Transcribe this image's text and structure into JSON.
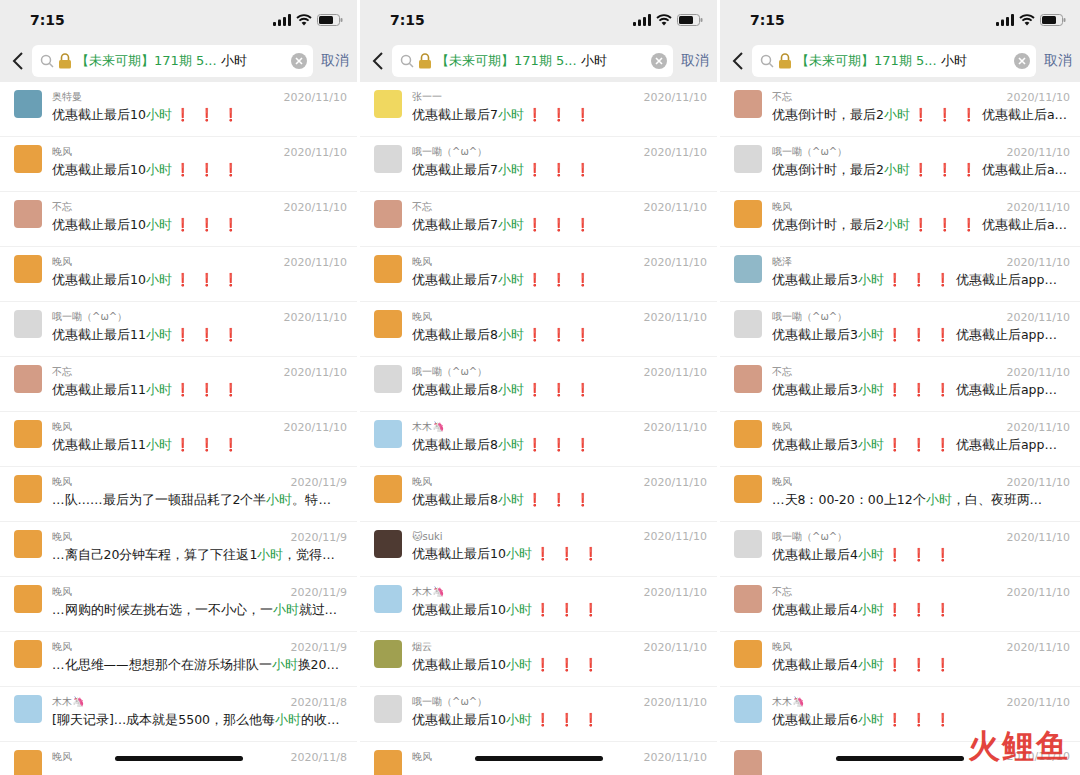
{
  "panels": [
    {
      "time": "7:15",
      "search": {
        "tag": "【未来可期】171期 5...",
        "query": "小时",
        "cancel": "取消"
      },
      "results": [
        {
          "name": "奥特曼",
          "date": "2020/11/10",
          "color": "#6a9fb5",
          "parts": [
            {
              "text": "优惠截止最后10",
              "kind": "plain"
            },
            {
              "text": "小时",
              "kind": "match"
            },
            {
              "text": "❗ ❗ ❗",
              "kind": "mark"
            }
          ]
        },
        {
          "name": "晚风",
          "date": "2020/11/10",
          "color": "#e8a040",
          "parts": [
            {
              "text": "优惠截止最后10",
              "kind": "plain"
            },
            {
              "text": "小时",
              "kind": "match"
            },
            {
              "text": "❗ ❗ ❗",
              "kind": "mark"
            }
          ]
        },
        {
          "name": "不忘",
          "date": "2020/11/10",
          "color": "#d39c86",
          "parts": [
            {
              "text": "优惠截止最后10",
              "kind": "plain"
            },
            {
              "text": "小时",
              "kind": "match"
            },
            {
              "text": "❗ ❗ ❗",
              "kind": "mark"
            }
          ]
        },
        {
          "name": "晚风",
          "date": "2020/11/10",
          "color": "#e8a040",
          "parts": [
            {
              "text": "优惠截止最后10",
              "kind": "plain"
            },
            {
              "text": "小时",
              "kind": "match"
            },
            {
              "text": "❗ ❗ ❗",
              "kind": "mark"
            }
          ]
        },
        {
          "name": "哦一嘞（^ω^）",
          "date": "2020/11/10",
          "color": "#d8d8d8",
          "parts": [
            {
              "text": "优惠截止最后11",
              "kind": "plain"
            },
            {
              "text": "小时",
              "kind": "match"
            },
            {
              "text": "❗ ❗ ❗",
              "kind": "mark"
            }
          ]
        },
        {
          "name": "不忘",
          "date": "2020/11/10",
          "color": "#d39c86",
          "parts": [
            {
              "text": "优惠截止最后11",
              "kind": "plain"
            },
            {
              "text": "小时",
              "kind": "match"
            },
            {
              "text": "❗ ❗ ❗",
              "kind": "mark"
            }
          ]
        },
        {
          "name": "晚风",
          "date": "2020/11/10",
          "color": "#e8a040",
          "parts": [
            {
              "text": "优惠截止最后11",
              "kind": "plain"
            },
            {
              "text": "小时",
              "kind": "match"
            },
            {
              "text": "❗ ❗ ❗",
              "kind": "mark"
            }
          ]
        },
        {
          "name": "晚风",
          "date": "2020/11/9",
          "color": "#e8a040",
          "parts": [
            {
              "text": "…队……最后为了一顿甜品耗了2个半",
              "kind": "plain"
            },
            {
              "text": "小时",
              "kind": "match"
            },
            {
              "text": "。特…",
              "kind": "plain"
            }
          ]
        },
        {
          "name": "晚风",
          "date": "2020/11/9",
          "color": "#e8a040",
          "parts": [
            {
              "text": "…离自己20分钟车程，算了下往返1",
              "kind": "plain"
            },
            {
              "text": "小时",
              "kind": "match"
            },
            {
              "text": "，觉得…",
              "kind": "plain"
            }
          ]
        },
        {
          "name": "晚风",
          "date": "2020/11/9",
          "color": "#e8a040",
          "parts": [
            {
              "text": "…网购的时候左挑右选，一不小心，一",
              "kind": "plain"
            },
            {
              "text": "小时",
              "kind": "match"
            },
            {
              "text": "就过…",
              "kind": "plain"
            }
          ]
        },
        {
          "name": "晚风",
          "date": "2020/11/9",
          "color": "#e8a040",
          "parts": [
            {
              "text": "…化思维——想想那个在游乐场排队一",
              "kind": "plain"
            },
            {
              "text": "小时",
              "kind": "match"
            },
            {
              "text": "换20…",
              "kind": "plain"
            }
          ]
        },
        {
          "name": "木木🦄",
          "date": "2020/11/8",
          "color": "#a8d0e8",
          "parts": [
            {
              "text": "[聊天记录]…成本就是5500，那么他每",
              "kind": "plain"
            },
            {
              "text": "小时",
              "kind": "match"
            },
            {
              "text": "的收…",
              "kind": "plain"
            }
          ]
        },
        {
          "name": "晚风",
          "date": "2020/11/8",
          "color": "#e8a040",
          "parts": []
        }
      ]
    },
    {
      "time": "7:15",
      "search": {
        "tag": "【未来可期】171期 5...",
        "query": "小时",
        "cancel": "取消"
      },
      "results": [
        {
          "name": "张一一",
          "date": "2020/11/10",
          "color": "#f0d860",
          "parts": [
            {
              "text": "优惠截止最后7",
              "kind": "plain"
            },
            {
              "text": "小时",
              "kind": "match"
            },
            {
              "text": "❗ ❗ ❗",
              "kind": "mark"
            }
          ]
        },
        {
          "name": "哦一嘞（^ω^）",
          "date": "2020/11/10",
          "color": "#d8d8d8",
          "parts": [
            {
              "text": "优惠截止最后7",
              "kind": "plain"
            },
            {
              "text": "小时",
              "kind": "match"
            },
            {
              "text": "❗ ❗ ❗",
              "kind": "mark"
            }
          ]
        },
        {
          "name": "不忘",
          "date": "2020/11/10",
          "color": "#d39c86",
          "parts": [
            {
              "text": "优惠截止最后7",
              "kind": "plain"
            },
            {
              "text": "小时",
              "kind": "match"
            },
            {
              "text": "❗ ❗ ❗",
              "kind": "mark"
            }
          ]
        },
        {
          "name": "晚风",
          "date": "2020/11/10",
          "color": "#e8a040",
          "parts": [
            {
              "text": "优惠截止最后7",
              "kind": "plain"
            },
            {
              "text": "小时",
              "kind": "match"
            },
            {
              "text": "❗ ❗ ❗",
              "kind": "mark"
            }
          ]
        },
        {
          "name": "晚风",
          "date": "2020/11/10",
          "color": "#e8a040",
          "parts": [
            {
              "text": "优惠截止最后8",
              "kind": "plain"
            },
            {
              "text": "小时",
              "kind": "match"
            },
            {
              "text": "❗ ❗ ❗",
              "kind": "mark"
            }
          ]
        },
        {
          "name": "哦一嘞（^ω^）",
          "date": "2020/11/10",
          "color": "#d8d8d8",
          "parts": [
            {
              "text": "优惠截止最后8",
              "kind": "plain"
            },
            {
              "text": "小时",
              "kind": "match"
            },
            {
              "text": "❗ ❗ ❗",
              "kind": "mark"
            }
          ]
        },
        {
          "name": "木木🦄",
          "date": "2020/11/10",
          "color": "#a8d0e8",
          "parts": [
            {
              "text": "优惠截止最后8",
              "kind": "plain"
            },
            {
              "text": "小时",
              "kind": "match"
            },
            {
              "text": "❗ ❗ ❗",
              "kind": "mark"
            }
          ]
        },
        {
          "name": "晚风",
          "date": "2020/11/10",
          "color": "#e8a040",
          "parts": [
            {
              "text": "优惠截止最后8",
              "kind": "plain"
            },
            {
              "text": "小时",
              "kind": "match"
            },
            {
              "text": "❗ ❗ ❗",
              "kind": "mark"
            }
          ]
        },
        {
          "name": "🐱suki",
          "date": "2020/11/10",
          "color": "#4e3a32",
          "parts": [
            {
              "text": "优惠截止最后10",
              "kind": "plain"
            },
            {
              "text": "小时",
              "kind": "match"
            },
            {
              "text": "❗ ❗ ❗",
              "kind": "mark"
            }
          ]
        },
        {
          "name": "木木🦄",
          "date": "2020/11/10",
          "color": "#a8d0e8",
          "parts": [
            {
              "text": "优惠截止最后10",
              "kind": "plain"
            },
            {
              "text": "小时",
              "kind": "match"
            },
            {
              "text": "❗ ❗ ❗",
              "kind": "mark"
            }
          ]
        },
        {
          "name": "烟云",
          "date": "2020/11/10",
          "color": "#a0a050",
          "parts": [
            {
              "text": "优惠截止最后10",
              "kind": "plain"
            },
            {
              "text": "小时",
              "kind": "match"
            },
            {
              "text": "❗ ❗ ❗",
              "kind": "mark"
            }
          ]
        },
        {
          "name": "哦一嘞（^ω^）",
          "date": "2020/11/10",
          "color": "#d8d8d8",
          "parts": [
            {
              "text": "优惠截止最后10",
              "kind": "plain"
            },
            {
              "text": "小时",
              "kind": "match"
            },
            {
              "text": "❗ ❗ ❗",
              "kind": "mark"
            }
          ]
        },
        {
          "name": "晚风",
          "date": "2020/11/10",
          "color": "#e8a040",
          "parts": []
        }
      ]
    },
    {
      "time": "7:15",
      "search": {
        "tag": "【未来可期】171期 5...",
        "query": "小时",
        "cancel": "取消"
      },
      "results": [
        {
          "name": "不忘",
          "date": "2020/11/10",
          "color": "#d39c86",
          "parts": [
            {
              "text": "优惠倒计时，最后2",
              "kind": "plain"
            },
            {
              "text": "小时",
              "kind": "match"
            },
            {
              "text": "❗ ❗ ❗",
              "kind": "mark"
            },
            {
              "text": "优惠截止后a…",
              "kind": "plain"
            }
          ]
        },
        {
          "name": "哦一嘞（^ω^）",
          "date": "2020/11/10",
          "color": "#d8d8d8",
          "parts": [
            {
              "text": "优惠倒计时，最后2",
              "kind": "plain"
            },
            {
              "text": "小时",
              "kind": "match"
            },
            {
              "text": "❗ ❗ ❗",
              "kind": "mark"
            },
            {
              "text": "优惠截止后a…",
              "kind": "plain"
            }
          ]
        },
        {
          "name": "晚风",
          "date": "2020/11/10",
          "color": "#e8a040",
          "parts": [
            {
              "text": "优惠倒计时，最后2",
              "kind": "plain"
            },
            {
              "text": "小时",
              "kind": "match"
            },
            {
              "text": "❗ ❗ ❗",
              "kind": "mark"
            },
            {
              "text": "优惠截止后a…",
              "kind": "plain"
            }
          ]
        },
        {
          "name": "晓泽",
          "date": "2020/11/10",
          "color": "#90b8c8",
          "parts": [
            {
              "text": "优惠截止最后3",
              "kind": "plain"
            },
            {
              "text": "小时",
              "kind": "match"
            },
            {
              "text": "❗ ❗ ❗",
              "kind": "mark"
            },
            {
              "text": "优惠截止后app…",
              "kind": "plain"
            }
          ]
        },
        {
          "name": "哦一嘞（^ω^）",
          "date": "2020/11/10",
          "color": "#d8d8d8",
          "parts": [
            {
              "text": "优惠截止最后3",
              "kind": "plain"
            },
            {
              "text": "小时",
              "kind": "match"
            },
            {
              "text": "❗ ❗ ❗",
              "kind": "mark"
            },
            {
              "text": "优惠截止后app…",
              "kind": "plain"
            }
          ]
        },
        {
          "name": "不忘",
          "date": "2020/11/10",
          "color": "#d39c86",
          "parts": [
            {
              "text": "优惠截止最后3",
              "kind": "plain"
            },
            {
              "text": "小时",
              "kind": "match"
            },
            {
              "text": "❗ ❗ ❗",
              "kind": "mark"
            },
            {
              "text": "优惠截止后app…",
              "kind": "plain"
            }
          ]
        },
        {
          "name": "晚风",
          "date": "2020/11/10",
          "color": "#e8a040",
          "parts": [
            {
              "text": "优惠截止最后3",
              "kind": "plain"
            },
            {
              "text": "小时",
              "kind": "match"
            },
            {
              "text": "❗ ❗ ❗",
              "kind": "mark"
            },
            {
              "text": "优惠截止后app…",
              "kind": "plain"
            }
          ]
        },
        {
          "name": "晚风",
          "date": "2020/11/10",
          "color": "#e8a040",
          "parts": [
            {
              "text": "…天8：00-20：00上12个",
              "kind": "plain"
            },
            {
              "text": "小时",
              "kind": "match"
            },
            {
              "text": "，白、夜班两…",
              "kind": "plain"
            }
          ]
        },
        {
          "name": "哦一嘞（^ω^）",
          "date": "2020/11/10",
          "color": "#d8d8d8",
          "parts": [
            {
              "text": "优惠截止最后4",
              "kind": "plain"
            },
            {
              "text": "小时",
              "kind": "match"
            },
            {
              "text": "❗ ❗ ❗",
              "kind": "mark"
            }
          ]
        },
        {
          "name": "不忘",
          "date": "2020/11/10",
          "color": "#d39c86",
          "parts": [
            {
              "text": "优惠截止最后4",
              "kind": "plain"
            },
            {
              "text": "小时",
              "kind": "match"
            },
            {
              "text": "❗ ❗ ❗",
              "kind": "mark"
            }
          ]
        },
        {
          "name": "晚风",
          "date": "2020/11/10",
          "color": "#e8a040",
          "parts": [
            {
              "text": "优惠截止最后4",
              "kind": "plain"
            },
            {
              "text": "小时",
              "kind": "match"
            },
            {
              "text": "❗ ❗ ❗",
              "kind": "mark"
            }
          ]
        },
        {
          "name": "木木🦄",
          "date": "2020/11/10",
          "color": "#a8d0e8",
          "parts": [
            {
              "text": "优惠截止最后6",
              "kind": "plain"
            },
            {
              "text": "小时",
              "kind": "match"
            },
            {
              "text": "❗ ❗ ❗",
              "kind": "mark"
            }
          ]
        },
        {
          "name": "",
          "date": "2020/11/10",
          "color": "#d39c86",
          "parts": []
        }
      ]
    }
  ],
  "watermark": "火鲤鱼"
}
